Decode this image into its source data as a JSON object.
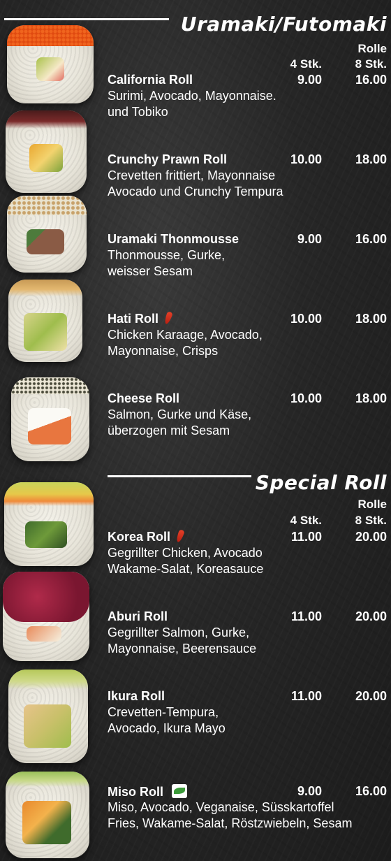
{
  "sections": [
    {
      "title": "Uramaki/Futomaki",
      "col_roll": "Rolle",
      "col_4": "4 Stk.",
      "col_8": "8 Stk.",
      "items": [
        {
          "name": "California Roll",
          "p4": "9.00",
          "p8": "16.00",
          "desc1": "Surimi, Avocado, Mayonnaise.",
          "desc2": "und Tobiko"
        },
        {
          "name": "Crunchy Prawn Roll",
          "p4": "10.00",
          "p8": "18.00",
          "desc1": "Crevetten frittiert, Mayonnaise",
          "desc2": "Avocado und Crunchy Tempura"
        },
        {
          "name": "Uramaki Thonmousse",
          "p4": "9.00",
          "p8": "16.00",
          "desc1": "Thonmousse, Gurke,",
          "desc2": "weisser Sesam"
        },
        {
          "name": "Hati Roll",
          "p4": "10.00",
          "p8": "18.00",
          "desc1": "Chicken Karaage, Avocado,",
          "desc2": "Mayonnaise, Crisps",
          "icon": "chili-icon"
        },
        {
          "name": "Cheese Roll",
          "p4": "10.00",
          "p8": "18.00",
          "desc1": "Salmon, Gurke und Käse,",
          "desc2": "überzogen mit Sesam"
        }
      ]
    },
    {
      "title": "Special Roll",
      "col_roll": "Rolle",
      "col_4": "4 Stk.",
      "col_8": "8 Stk.",
      "items": [
        {
          "name": "Korea Roll",
          "p4": "11.00",
          "p8": "20.00",
          "desc1": "Gegrillter Chicken, Avocado",
          "desc2": "Wakame-Salat, Koreasauce",
          "icon": "chili-icon"
        },
        {
          "name": "Aburi Roll",
          "p4": "11.00",
          "p8": "20.00",
          "desc1": "Gegrillter Salmon, Gurke,",
          "desc2": "Mayonnaise, Beerensauce"
        },
        {
          "name": "Ikura Roll",
          "p4": "11.00",
          "p8": "20.00",
          "desc1": "Crevetten-Tempura,",
          "desc2": "Avocado, Ikura Mayo"
        },
        {
          "name": "Miso Roll",
          "p4": "9.00",
          "p8": "16.00",
          "desc1": "Miso, Avocado, Veganaise, Süsskartoffel",
          "desc2": "Fries, Wakame-Salat, Röstzwiebeln, Sesam",
          "icon": "vegan-leaf-icon"
        }
      ]
    }
  ]
}
